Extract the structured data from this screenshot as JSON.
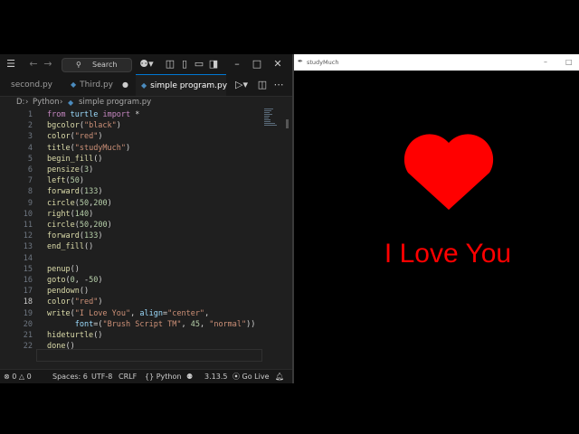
{
  "vscode": {
    "search_label": "Search",
    "tabs": [
      {
        "label": "second.py",
        "active": false
      },
      {
        "label": "Third.py",
        "active": false
      },
      {
        "label": "simple program.py",
        "active": true
      }
    ],
    "breadcrumb": [
      "D:",
      "Python",
      "simple program.py"
    ],
    "lines": [
      {
        "num": "1",
        "text": "from turtle import *"
      },
      {
        "num": "2",
        "text": "bgcolor(\"black\")"
      },
      {
        "num": "3",
        "text": "color(\"red\")"
      },
      {
        "num": "4",
        "text": "title(\"studyMuch\")"
      },
      {
        "num": "5",
        "text": "begin_fill()"
      },
      {
        "num": "6",
        "text": "pensize(3)"
      },
      {
        "num": "7",
        "text": "left(50)"
      },
      {
        "num": "8",
        "text": "forward(133)"
      },
      {
        "num": "9",
        "text": "circle(50,200)"
      },
      {
        "num": "10",
        "text": "right(140)"
      },
      {
        "num": "11",
        "text": "circle(50,200)"
      },
      {
        "num": "12",
        "text": "forward(133)"
      },
      {
        "num": "13",
        "text": "end_fill()"
      },
      {
        "num": "14",
        "text": ""
      },
      {
        "num": "15",
        "text": "penup()"
      },
      {
        "num": "16",
        "text": "goto(0, -50)"
      },
      {
        "num": "17",
        "text": "pendown()"
      },
      {
        "num": "18",
        "text": "color(\"red\")"
      },
      {
        "num": "19",
        "text": "write(\"I Love You\", align=\"center\","
      },
      {
        "num": "20",
        "text": "      font=(\"Brush Script TM\", 45, \"normal\"))"
      },
      {
        "num": "21",
        "text": "hideturtle()"
      },
      {
        "num": "22",
        "text": "done()"
      }
    ],
    "current_line": "18",
    "status": {
      "errors": "0",
      "warnings": "0",
      "spaces": "Spaces: 6",
      "encoding": "UTF-8",
      "eol": "CRLF",
      "language": "Python",
      "version": "3.13.5",
      "golive": "Go Live"
    }
  },
  "turtle_window": {
    "title": "studyMuch",
    "text": "I Love You",
    "heart_color": "#ff0000"
  }
}
